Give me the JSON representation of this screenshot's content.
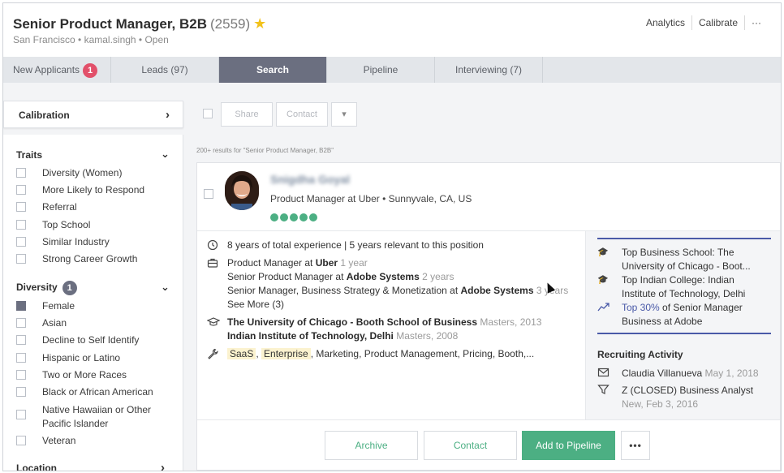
{
  "header": {
    "title": "Senior Product Manager, B2B",
    "count": "(2559)",
    "subtitle": "San Francisco • kamal.singh • Open",
    "links": {
      "analytics": "Analytics",
      "calibrate": "Calibrate",
      "more": "···"
    }
  },
  "tabs": [
    {
      "label": "New Applicants",
      "badge": "1"
    },
    {
      "label": "Leads (97)"
    },
    {
      "label": "Search",
      "active": true
    },
    {
      "label": "Pipeline"
    },
    {
      "label": "Interviewing (7)"
    }
  ],
  "sidebar": {
    "calibration": "Calibration",
    "traits": {
      "title": "Traits",
      "items": [
        "Diversity (Women)",
        "More Likely to Respond",
        "Referral",
        "Top School",
        "Similar Industry",
        "Strong Career Growth"
      ]
    },
    "diversity": {
      "title": "Diversity",
      "badge": "1",
      "items": [
        "Female",
        "Asian",
        "Decline to Self Identify",
        "Hispanic or Latino",
        "Two or More Races",
        "Black or African American",
        "Native Hawaiian or Other Pacific Islander",
        "Veteran"
      ],
      "checked_index": 0
    },
    "location": {
      "title": "Location"
    }
  },
  "toolbar": {
    "share": "Share",
    "contact": "Contact",
    "results": "200+ results for \"Senior Product Manager, B2B\""
  },
  "candidate": {
    "name": "Snigdha Goyal",
    "role": "Product Manager at Uber • Sunnyvale, CA, US",
    "match_score": 5,
    "experience_summary": "8 years of total experience | 5 years relevant to this position",
    "jobs": [
      {
        "title": "Product Manager at ",
        "company": "Uber",
        "duration": "1 year"
      },
      {
        "title": "Senior Product Manager at ",
        "company": "Adobe Systems",
        "duration": "2 years"
      },
      {
        "title": "Senior Manager, Business Strategy & Monetization at ",
        "company": "Adobe Systems",
        "duration": "3 years"
      }
    ],
    "see_more": "See More (3)",
    "education": [
      {
        "school": "The University of Chicago - Booth School of Business",
        "detail": "Masters, 2013"
      },
      {
        "school": "Indian Institute of Technology, Delhi",
        "detail": "Masters, 2008"
      }
    ],
    "skills_tags": [
      "SaaS",
      "Enterprise"
    ],
    "skills_rest": ", Marketing, Product Management, Pricing, Booth,..."
  },
  "highlights": {
    "items": [
      {
        "line1": "Top Business School: The",
        "line2": "University of Chicago - Boot..."
      },
      {
        "line1": "Top Indian College: Indian",
        "line2": "Institute of Technology, Delhi"
      },
      {
        "link": "Top 30%",
        "line1_rest": " of Senior Manager",
        "line2": "Business at Adobe"
      }
    ]
  },
  "recruiting": {
    "title": "Recruiting Activity",
    "items": [
      {
        "name": "Claudia Villanueva",
        "date": "May 1, 2018"
      },
      {
        "name": "Z (CLOSED) Business Analyst",
        "date": "New, Feb 3, 2016"
      }
    ]
  },
  "actions": {
    "archive": "Archive",
    "contact": "Contact",
    "add": "Add to Pipeline",
    "more": "•••"
  },
  "colors": {
    "accent": "#6b6f80",
    "green": "#4caf83",
    "badge_red": "#e2506a",
    "link": "#4a5aa8"
  }
}
